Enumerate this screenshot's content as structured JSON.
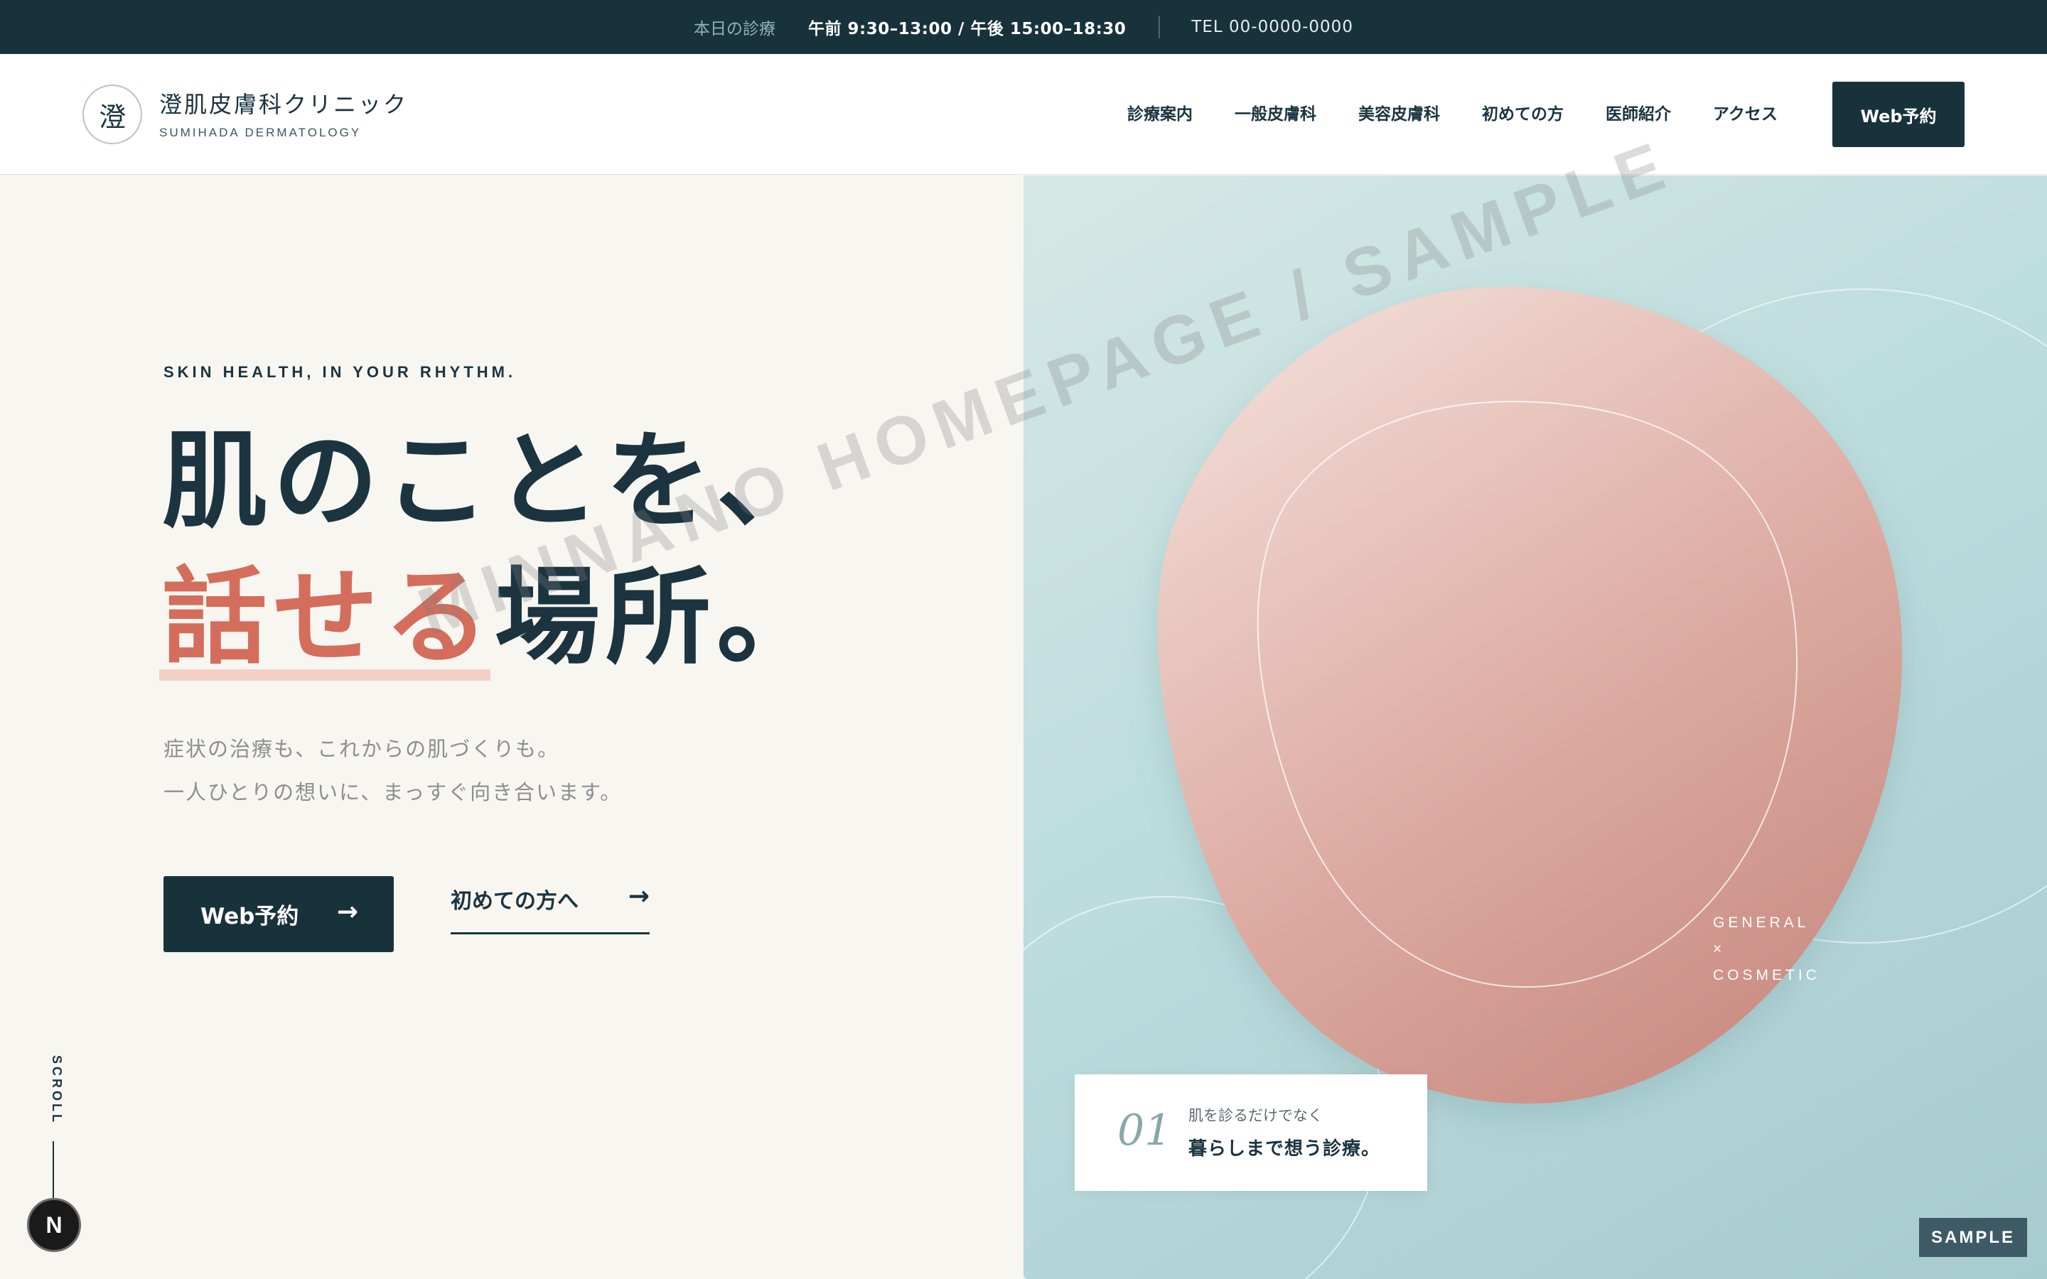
{
  "topbar": {
    "label": "本日の診療",
    "hours": "午前 9:30–13:00 / 午後 15:00–18:30",
    "tel": "TEL 00-0000-0000"
  },
  "header": {
    "logo_mark": "澄",
    "clinic_name": "澄肌皮膚科クリニック",
    "clinic_name_en": "SUMIHADA DERMATOLOGY",
    "nav": [
      "診療案内",
      "一般皮膚科",
      "美容皮膚科",
      "初めての方",
      "医師紹介",
      "アクセス"
    ],
    "cta": "Web予約"
  },
  "hero": {
    "tagline": "SKIN HEALTH, IN YOUR RHYTHM.",
    "headline_line1": "肌のことを、",
    "headline_accent": "話せる",
    "headline_line2_rest": "場所。",
    "lead_1": "症状の治療も、これからの肌づくりも。",
    "lead_2": "一人ひとりの想いに、まっすぐ向き合います。",
    "primary_button": "Web予約",
    "secondary_button": "初めての方へ",
    "arrow": "→",
    "scroll": "SCROLL",
    "badge": "N"
  },
  "visual": {
    "label_1": "GENERAL",
    "label_2": "×",
    "label_3": "COSMETIC",
    "card_number": "01",
    "card_small": "肌を診るだけでなく",
    "card_big": "暮らしまで想う診療。"
  },
  "watermark": "MINNANO HOMEPAGE / SAMPLE",
  "sample_badge": "SAMPLE",
  "colors": {
    "dark": "#18323c",
    "accent": "#d46d5b",
    "accent_soft": "#f2d0c8",
    "teal_bg": "#bcdcdd",
    "blob": "#d9a49a",
    "cream": "#f8f6f1"
  }
}
